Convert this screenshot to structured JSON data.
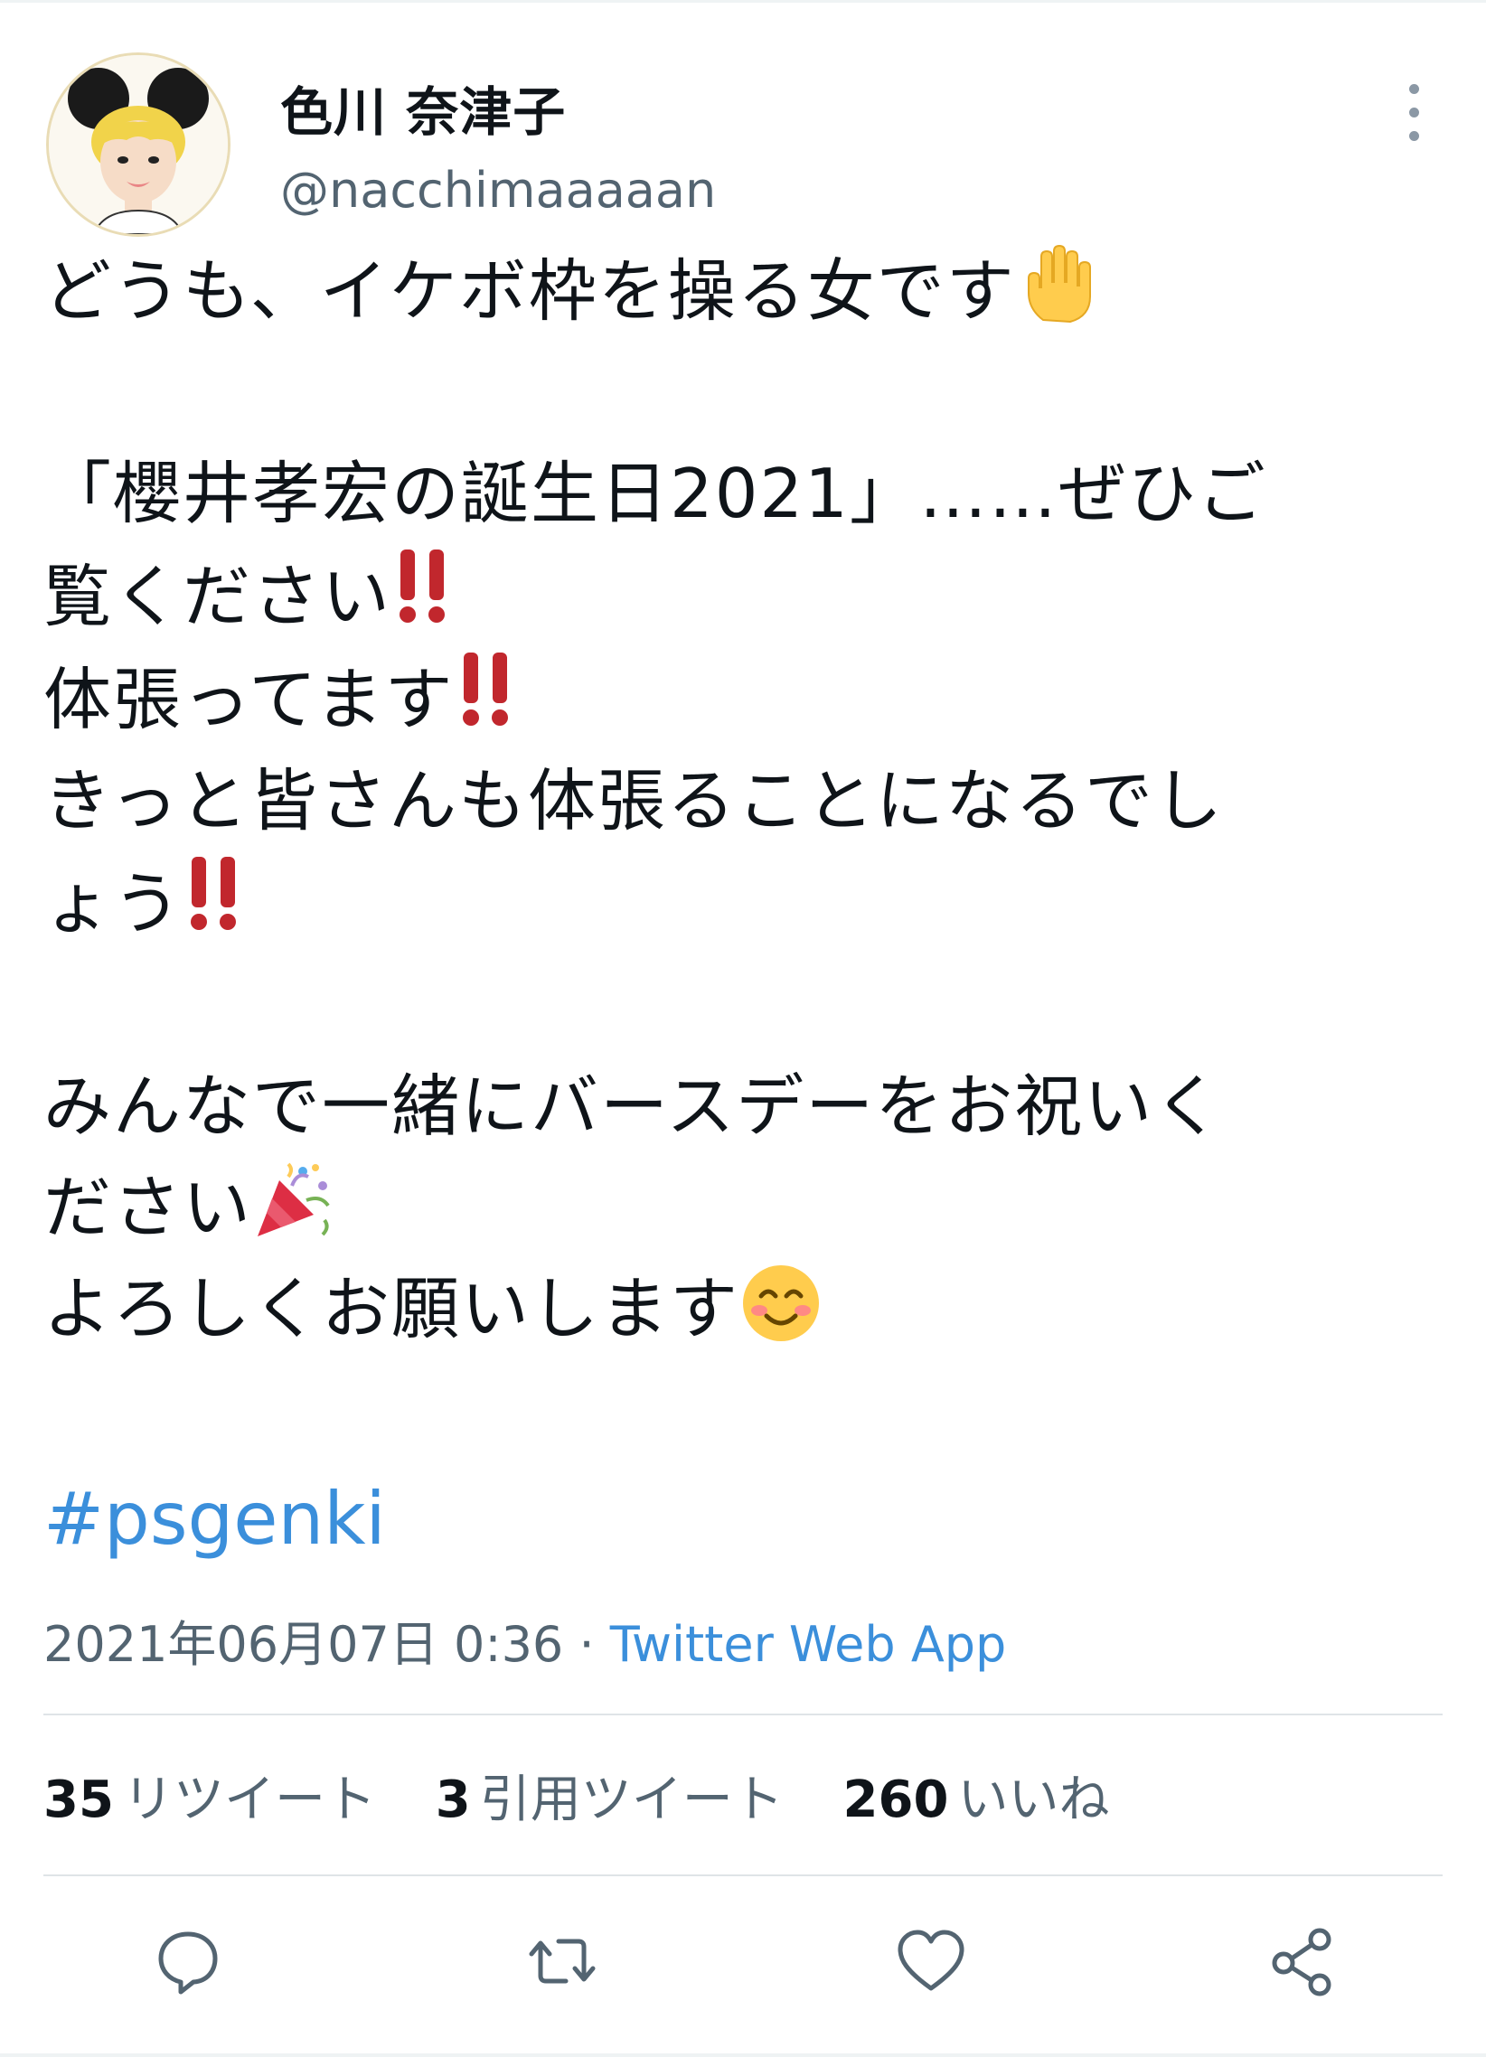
{
  "author": {
    "display_name": "色川 奈津子",
    "handle": "@nacchimaaaaan"
  },
  "tweet": {
    "line1": "どうも、イケボ枠を操る女です",
    "line2a": "「櫻井孝宏の誕生日2021」……ぜひご",
    "line2b": "覧ください",
    "line3": "体張ってます",
    "line4a": "きっと皆さんも体張ることになるでし",
    "line4b": "ょう",
    "line5a": "みんなで一緒にバースデーをお祝いく",
    "line5b": "ださい",
    "line6": "よろしくお願いします",
    "hashtag": "#psgenki"
  },
  "meta": {
    "timestamp": "2021年06月07日 0:36",
    "separator": " · ",
    "source": "Twitter Web App"
  },
  "stats": {
    "retweets_count": "35",
    "retweets_label": "リツイート",
    "quotes_count": "3",
    "quotes_label": "引用ツイート",
    "likes_count": "260",
    "likes_label": "いいね"
  },
  "icons": {
    "more": "more-vertical-icon",
    "reply": "reply-icon",
    "retweet": "retweet-icon",
    "like": "heart-icon",
    "share": "share-icon"
  },
  "colors": {
    "link": "#3b8fdb",
    "secondary_text": "#536471",
    "bangbang": "#c1272d"
  }
}
